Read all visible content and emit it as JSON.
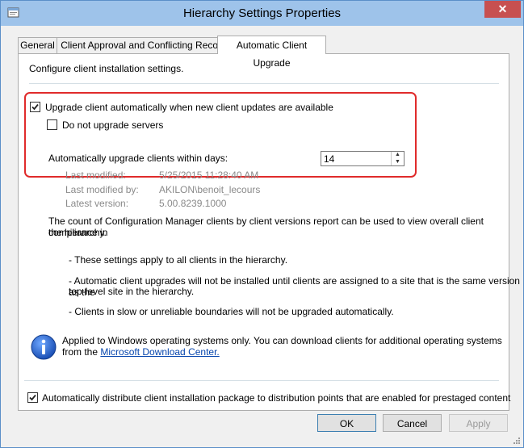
{
  "window": {
    "title": "Hierarchy Settings Properties",
    "close_glyph": "✕"
  },
  "tabs": [
    {
      "label": "General"
    },
    {
      "label": "Client Approval and Conflicting Records"
    },
    {
      "label": "Automatic Client Upgrade"
    }
  ],
  "panel": {
    "intro": "Configure client installation settings.",
    "upgrade_auto": {
      "label": "Upgrade client automatically when new client updates are available",
      "checked": true
    },
    "no_upgrade_servers": {
      "label": "Do not upgrade servers",
      "checked": false
    },
    "days": {
      "label": "Automatically upgrade clients within days:",
      "value": "14"
    },
    "meta": {
      "last_modified_label": "Last modified:",
      "last_modified_value": "5/25/2015 11:28:40 AM",
      "last_modified_by_label": "Last modified by:",
      "last_modified_by_value": "AKILON\\benoit_lecours",
      "latest_version_label": "Latest version:",
      "latest_version_value": "5.00.8239.1000"
    },
    "report_line1": "The count of Configuration Manager clients by client versions report can be used to view overall client compliance in",
    "report_line2": "the hierarchy.",
    "note1": "- These settings apply to all clients in the hierarchy.",
    "note2_line1": "- Automatic client upgrades will not be installed until clients are assigned to a site that is the same version as the",
    "note2_line2": "top-level site in the hierarchy.",
    "note3": "- Clients in slow or unreliable boundaries will not be upgraded automatically.",
    "info_line1": "Applied to Windows operating systems only. You can download clients for additional operating systems",
    "info_line2_prefix": "from the ",
    "info_link": "Microsoft Download Center.",
    "distribute": {
      "label": "Automatically distribute client installation package to distribution points that are enabled for prestaged content",
      "checked": true
    }
  },
  "buttons": {
    "ok": "OK",
    "cancel": "Cancel",
    "apply": "Apply"
  },
  "colors": {
    "titlebar": "#9ec3ea",
    "close": "#c75050",
    "highlight": "#e02b2b",
    "link": "#0645ad"
  }
}
